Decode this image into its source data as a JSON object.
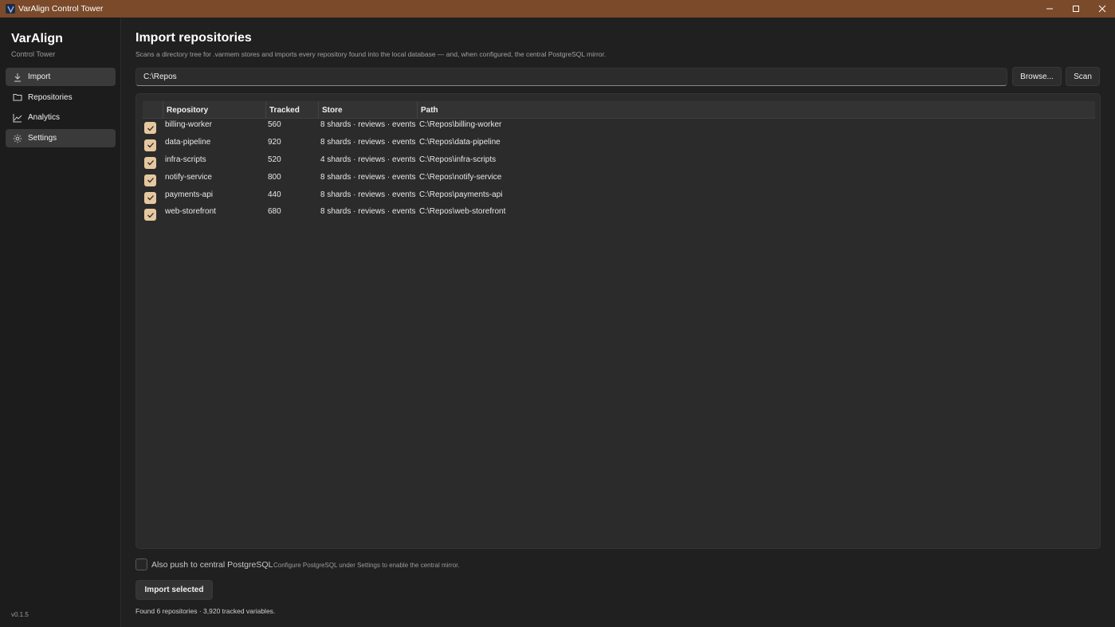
{
  "window": {
    "title": "VarAlign Control Tower",
    "titlebar_color": "#7a4a2a",
    "controls": [
      "minimize-icon",
      "maximize-icon",
      "close-icon"
    ]
  },
  "sidebar": {
    "brand": "VarAlign",
    "subtitle": "Control Tower",
    "items": [
      {
        "label": "Import",
        "icon": "download-icon",
        "active": true
      },
      {
        "label": "Repositories",
        "icon": "folder-icon",
        "active": false
      },
      {
        "label": "Analytics",
        "icon": "chart-icon",
        "active": false
      },
      {
        "label": "Settings",
        "icon": "gear-icon",
        "active": true
      }
    ],
    "version": "v0.1.5"
  },
  "main": {
    "title": "Import repositories",
    "description": "Scans a directory tree for .varmem stores and imports every repository found into the local database — and, when configured, the central PostgreSQL mirror.",
    "path_value": "C:\\Repos",
    "browse_label": "Browse...",
    "scan_label": "Scan",
    "table": {
      "headers": [
        "Repository",
        "Tracked",
        "Store",
        "Path"
      ],
      "rows": [
        {
          "checked": true,
          "repository": "billing-worker",
          "tracked": "560",
          "store": "8 shards · reviews · events",
          "path": "C:\\Repos\\billing-worker"
        },
        {
          "checked": true,
          "repository": "data-pipeline",
          "tracked": "920",
          "store": "8 shards · reviews · events",
          "path": "C:\\Repos\\data-pipeline"
        },
        {
          "checked": true,
          "repository": "infra-scripts",
          "tracked": "520",
          "store": "4 shards · reviews · events",
          "path": "C:\\Repos\\infra-scripts"
        },
        {
          "checked": true,
          "repository": "notify-service",
          "tracked": "800",
          "store": "8 shards · reviews · events",
          "path": "C:\\Repos\\notify-service"
        },
        {
          "checked": true,
          "repository": "payments-api",
          "tracked": "440",
          "store": "8 shards · reviews · events",
          "path": "C:\\Repos\\payments-api"
        },
        {
          "checked": true,
          "repository": "web-storefront",
          "tracked": "680",
          "store": "8 shards · reviews · events",
          "path": "C:\\Repos\\web-storefront"
        }
      ]
    },
    "mirror_checkbox": {
      "checked": false,
      "label": "Also push to central PostgreSQL",
      "hint": "Configure PostgreSQL under Settings to enable the central mirror."
    },
    "import_label": "Import selected",
    "status": "Found 6 repositories · 3,920 tracked variables.",
    "accent_color": "#e6c8a0"
  }
}
